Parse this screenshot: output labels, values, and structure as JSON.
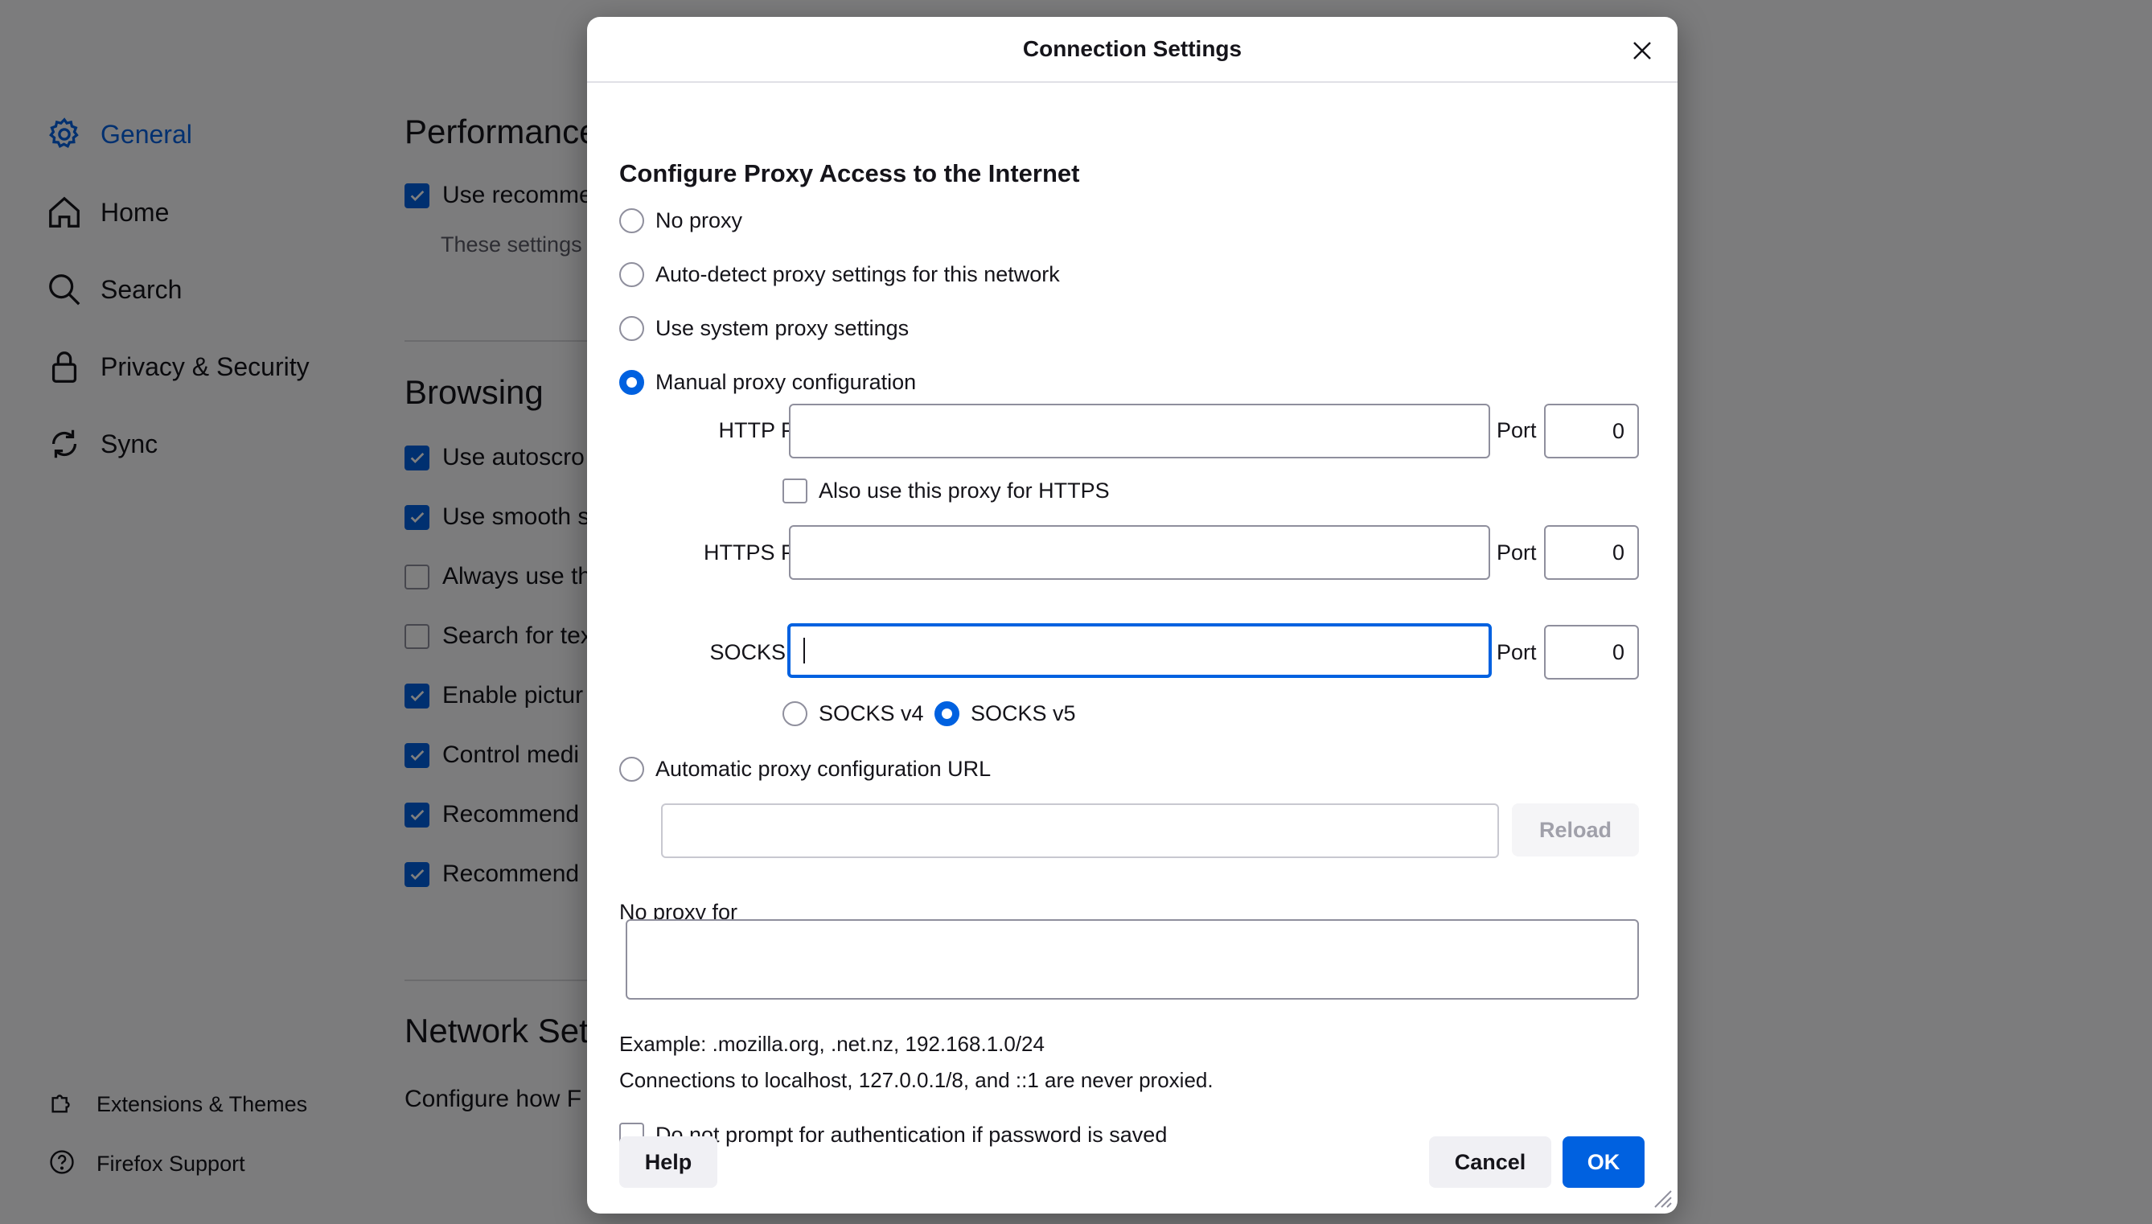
{
  "colors": {
    "accent": "#0061e0",
    "overlay": "rgba(0,0,0,0.5)"
  },
  "sidebar": {
    "items": [
      {
        "label": "General",
        "icon": "gear-icon",
        "active": true
      },
      {
        "label": "Home",
        "icon": "home-icon"
      },
      {
        "label": "Search",
        "icon": "search-icon"
      },
      {
        "label": "Privacy & Security",
        "icon": "lock-icon"
      },
      {
        "label": "Sync",
        "icon": "sync-icon"
      }
    ],
    "footer": [
      {
        "label": "Extensions & Themes",
        "icon": "puzzle-icon"
      },
      {
        "label": "Firefox Support",
        "icon": "help-icon"
      }
    ]
  },
  "background": {
    "performance": {
      "title": "Performance",
      "checkbox_label": "Use recomme",
      "note": "These settings"
    },
    "browsing": {
      "title": "Browsing",
      "items": [
        {
          "label": "Use autoscro",
          "checked": true
        },
        {
          "label": "Use smooth s",
          "checked": true
        },
        {
          "label": "Always use th",
          "checked": false
        },
        {
          "label": "Search for tex",
          "checked": false
        },
        {
          "label": "Enable pictur",
          "checked": true
        },
        {
          "label": "Control medi",
          "checked": true
        },
        {
          "label": "Recommend",
          "checked": true
        },
        {
          "label": "Recommend",
          "checked": true
        }
      ]
    },
    "network": {
      "title": "Network Set",
      "text": "Configure how F"
    }
  },
  "dialog": {
    "title": "Connection Settings",
    "heading": "Configure Proxy Access to the Internet",
    "options": {
      "no_proxy": "No proxy",
      "auto_detect": "Auto-detect proxy settings for this network",
      "system": "Use system proxy settings",
      "manual": "Manual proxy configuration",
      "auto_url": "Automatic proxy configuration URL"
    },
    "selected_option": "manual",
    "http_proxy": {
      "label": "HTTP Proxy",
      "value": "",
      "port_label": "Port",
      "port": "0"
    },
    "also_https": {
      "label": "Also use this proxy for HTTPS",
      "checked": false
    },
    "https_proxy": {
      "label": "HTTPS Proxy",
      "value": "",
      "port_label": "Port",
      "port": "0"
    },
    "socks": {
      "label": "SOCKS Host",
      "value": "",
      "port_label": "Port",
      "port": "0",
      "v4": "SOCKS v4",
      "v5": "SOCKS v5",
      "selected": "v5"
    },
    "auto_url_value": "",
    "reload": "Reload",
    "no_proxy_for": {
      "label": "No proxy for",
      "value": ""
    },
    "example": "Example: .mozilla.org, .net.nz, 192.168.1.0/24",
    "localhost_note": "Connections to localhost, 127.0.0.1/8, and ::1 are never proxied.",
    "no_prompt": {
      "label": "Do not prompt for authentication if password is saved",
      "checked": false
    },
    "buttons": {
      "help": "Help",
      "cancel": "Cancel",
      "ok": "OK"
    }
  }
}
